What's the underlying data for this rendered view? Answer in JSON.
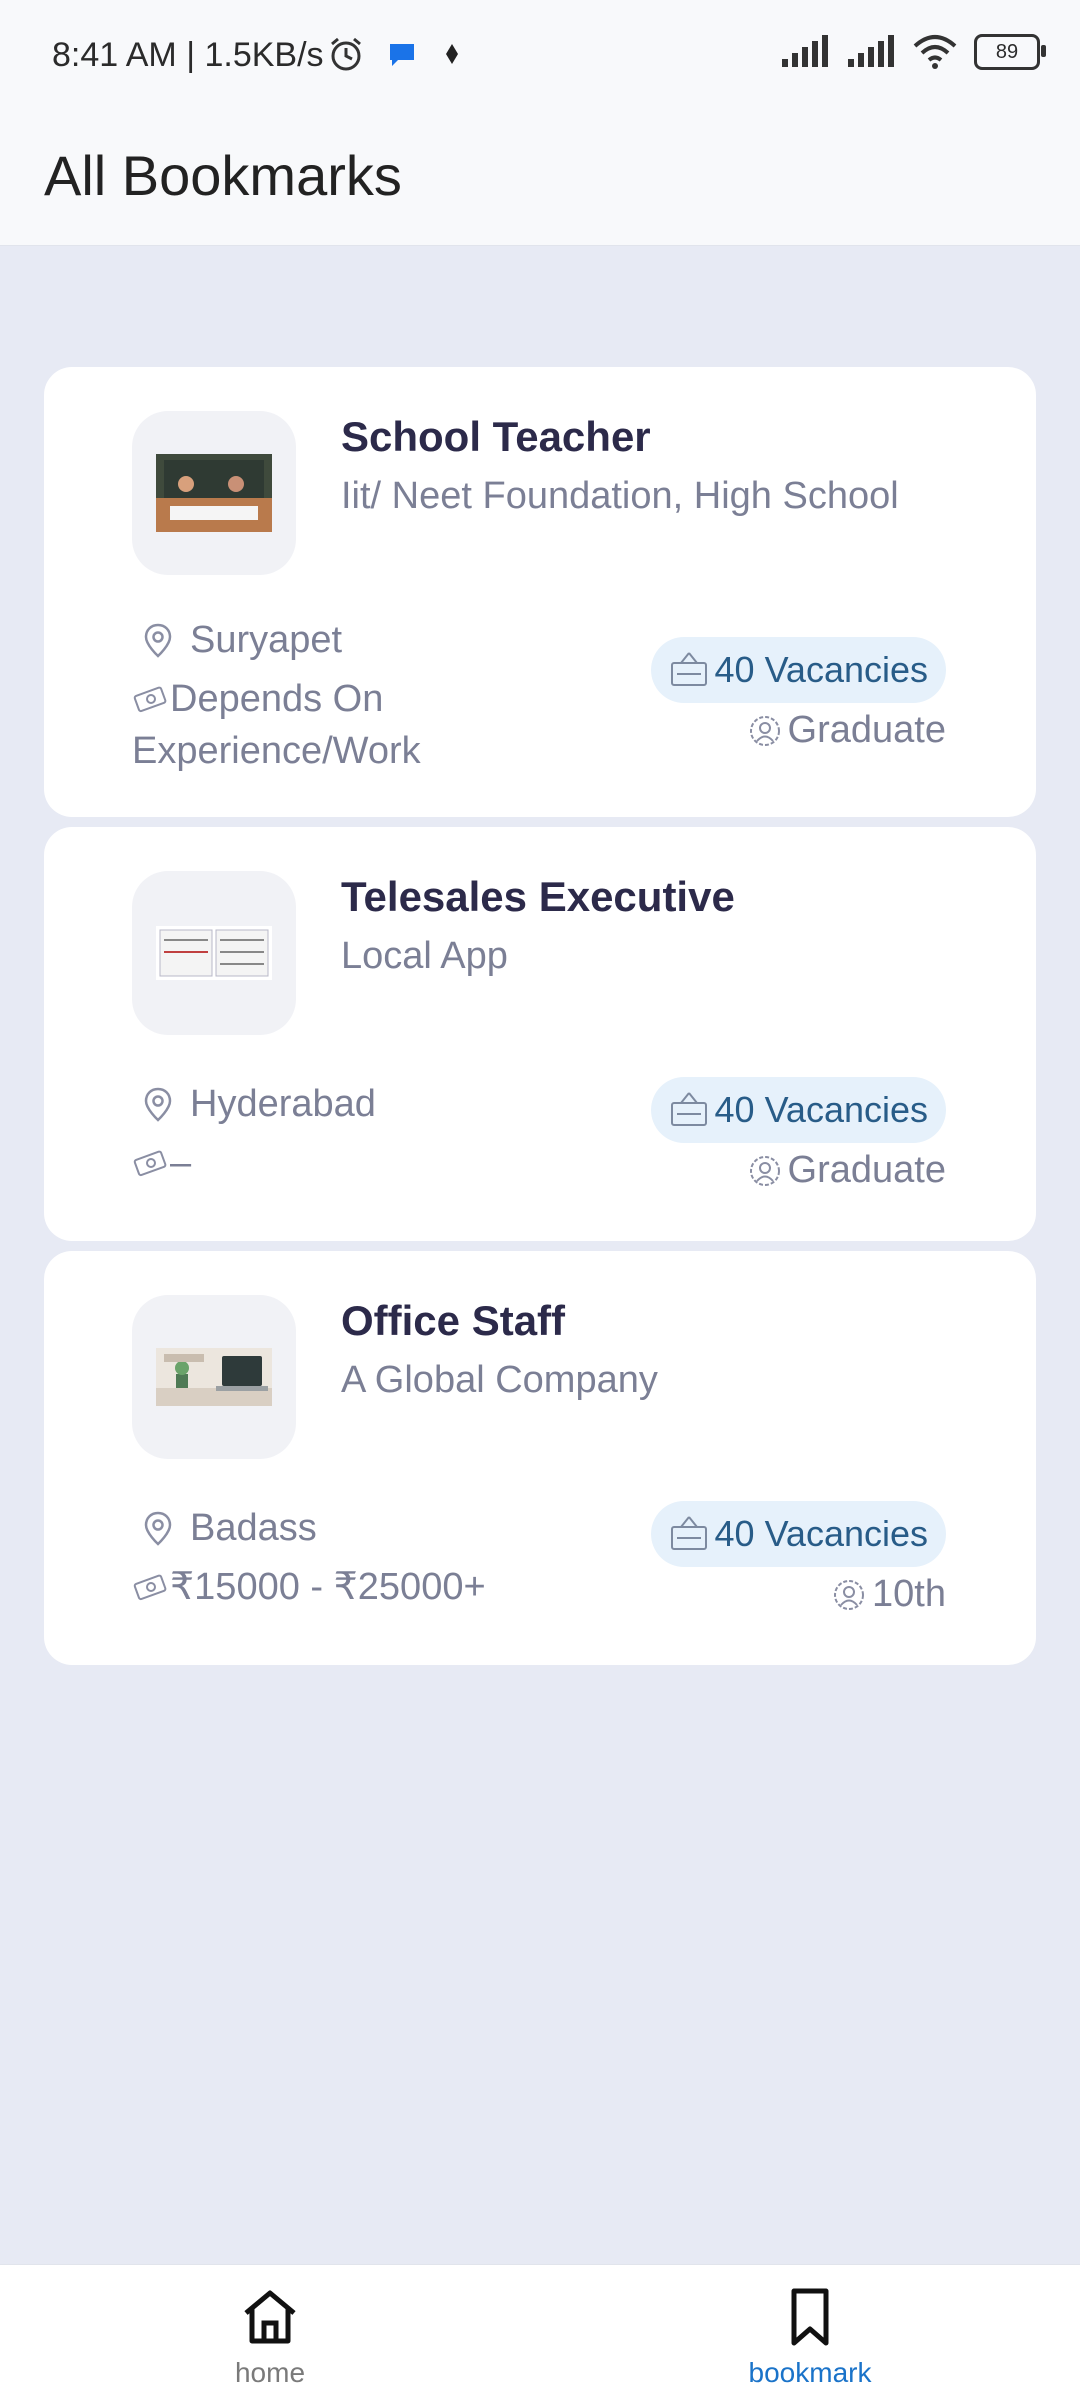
{
  "status_bar": {
    "time": "8:41 AM | 1.5KB/s",
    "battery": "89"
  },
  "appbar": {
    "title": "All Bookmarks"
  },
  "jobs": [
    {
      "title": "School Teacher",
      "company": "Iit/ Neet Foundation, High School",
      "location": "Suryapet",
      "salary": "Depends On Experience/Work",
      "vacancies": "40 Vacancies",
      "education": "Graduate"
    },
    {
      "title": "Telesales Executive",
      "company": "Local App",
      "location": "Hyderabad",
      "salary": "–",
      "vacancies": "40 Vacancies",
      "education": "Graduate"
    },
    {
      "title": "Office Staff",
      "company": "A Global Company",
      "location": "Badass",
      "salary": "₹15000 - ₹25000+",
      "vacancies": "40 Vacancies",
      "education": "10th"
    }
  ],
  "bottom_nav": {
    "home_label": "home",
    "bookmark_label": "bookmark",
    "active": "bookmark",
    "colors": {
      "active": "#1a73c9",
      "inactive": "#7a7a7a"
    }
  }
}
